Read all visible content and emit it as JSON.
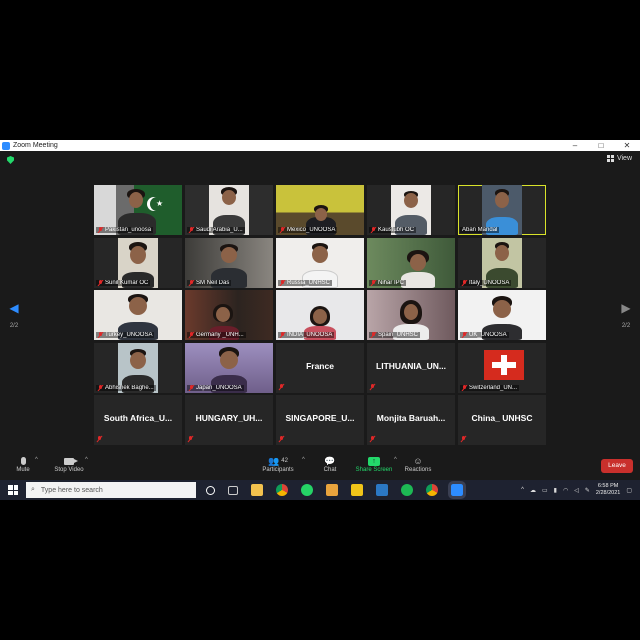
{
  "window": {
    "title": "Zoom Meeting",
    "minimize": "–",
    "maximize": "□",
    "close": "✕"
  },
  "view_label": "View",
  "page_left": "2/2",
  "page_right": "2/2",
  "tiles": [
    {
      "name": "Pakistan_unoosa",
      "video": true
    },
    {
      "name": "Saudi Arabia_U...",
      "video": true
    },
    {
      "name": "Mexico_UNOOSA",
      "video": true
    },
    {
      "name": "Kaustubh OC",
      "video": true
    },
    {
      "name": "Aban Mandal",
      "video": true,
      "active": true
    },
    {
      "name": "Sunil Kumar OC",
      "video": true
    },
    {
      "name": "SM Neil Das",
      "video": true
    },
    {
      "name": "Russia_UNHSC",
      "video": true
    },
    {
      "name": "Nihar IPC",
      "video": true
    },
    {
      "name": "Italy_UNOOSA",
      "video": true
    },
    {
      "name": "Turkey_UNOOSA",
      "video": true
    },
    {
      "name": "Germany _UNH...",
      "video": true
    },
    {
      "name": "INDIA_UNOOSA",
      "video": true
    },
    {
      "name": "Spain_UNHSC",
      "video": true
    },
    {
      "name": "UK_UNOOSA",
      "video": true
    },
    {
      "name": "Abhishek Baghe...",
      "video": true
    },
    {
      "name": "Japan_UNOOSA",
      "video": true
    },
    {
      "name": "France",
      "video": false
    },
    {
      "name": "LITHUANIA_UN...",
      "video": false
    },
    {
      "name": "Switzerland_UN...",
      "video": true
    },
    {
      "name": "South Africa_U...",
      "video": false
    },
    {
      "name": "HUNGARY_UH...",
      "video": false
    },
    {
      "name": "SINGAPORE_U...",
      "video": false
    },
    {
      "name": "Monjita Baruah...",
      "video": false
    },
    {
      "name": "China_ UNHSC",
      "video": false
    }
  ],
  "controls": {
    "mute": "Mute",
    "stop_video": "Stop Video",
    "participants": "Participants",
    "participant_count": "42",
    "chat": "Chat",
    "share_screen": "Share Screen",
    "reactions": "Reactions",
    "leave": "Leave"
  },
  "taskbar": {
    "search_placeholder": "Type here to search",
    "time": "6:58 PM",
    "date": "2/28/2021"
  },
  "colors": {
    "active_speaker_border": "#d9e32a",
    "share_green": "#23d96b",
    "leave_red": "#c9302c",
    "zoom_blue": "#2d8cff"
  }
}
